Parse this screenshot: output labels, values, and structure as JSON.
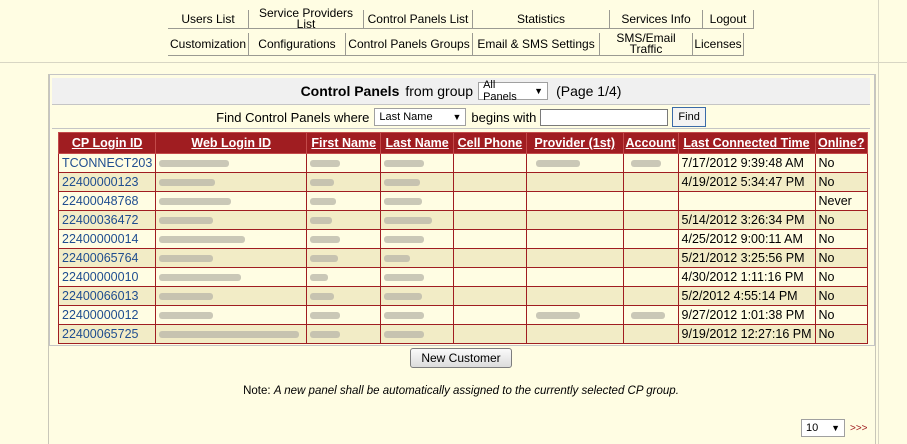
{
  "nav": {
    "row1": [
      "Users List",
      "Service Providers List",
      "Control Panels List",
      "Statistics",
      "Services Info",
      "Logout"
    ],
    "row2": [
      "Customization",
      "Configurations",
      "Control Panels Groups",
      "Email & SMS Settings",
      "SMS/Email Traffic",
      "Licenses"
    ]
  },
  "title": {
    "prefix": "Control Panels",
    "from_group": "from group",
    "group_value": "All Panels",
    "page": "(Page 1/4)"
  },
  "find": {
    "label": "Find Control Panels where",
    "field_value": "Last Name",
    "begins_with": "begins with",
    "input_value": "",
    "button": "Find"
  },
  "table": {
    "headers": [
      "CP Login ID",
      "Web Login ID",
      "First Name",
      "Last Name",
      "Cell Phone",
      "Provider (1st)",
      "Account",
      "Last Connected Time",
      "Online?"
    ],
    "rows": [
      {
        "cp": "TCONNECT203",
        "last_connected": "7/17/2012 9:39:48 AM",
        "online": "No"
      },
      {
        "cp": "22400000123",
        "last_connected": "4/19/2012 5:34:47 PM",
        "online": "No"
      },
      {
        "cp": "22400048768",
        "last_connected": "",
        "online": "Never"
      },
      {
        "cp": "22400036472",
        "last_connected": "5/14/2012 3:26:34 PM",
        "online": "No"
      },
      {
        "cp": "22400000014",
        "last_connected": "4/25/2012 9:00:11 AM",
        "online": "No"
      },
      {
        "cp": "22400065764",
        "last_connected": "5/21/2012 3:25:56 PM",
        "online": "No"
      },
      {
        "cp": "22400000010",
        "last_connected": "4/30/2012 1:11:16 PM",
        "online": "No"
      },
      {
        "cp": "22400066013",
        "last_connected": "5/2/2012 4:55:14 PM",
        "online": "No"
      },
      {
        "cp": "22400000012",
        "last_connected": "9/27/2012 1:01:38 PM",
        "online": "No"
      },
      {
        "cp": "22400065725",
        "last_connected": "9/19/2012 12:27:16 PM",
        "online": "No"
      }
    ]
  },
  "actions": {
    "new_customer": "New Customer"
  },
  "note": {
    "prefix": "Note:",
    "text": "A new panel shall be automatically assigned to the currently selected CP group."
  },
  "pagination": {
    "page_size": "10",
    "next": ">>>"
  }
}
